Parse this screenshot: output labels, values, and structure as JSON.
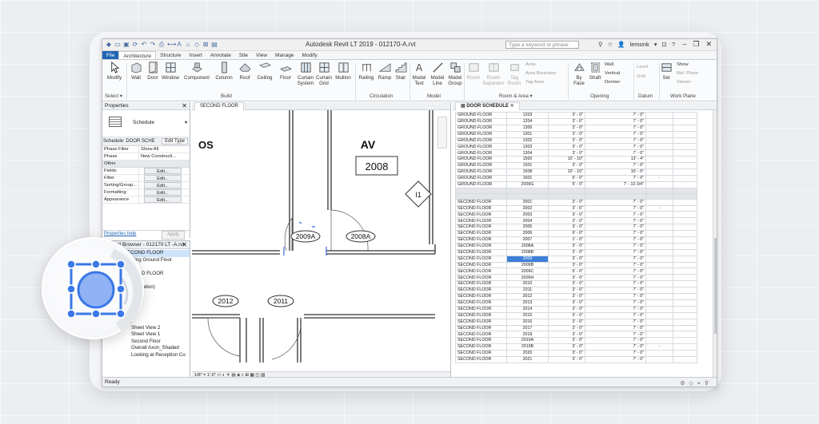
{
  "app": {
    "title": "Autodesk Revit LT 2019 - 012170-A.rvt",
    "search_placeholder": "Type a keyword or phrase",
    "user": "lemonk",
    "accent": "#1f65b5"
  },
  "tabs": [
    "File",
    "Architecture",
    "Structure",
    "Insert",
    "Annotate",
    "Site",
    "View",
    "Manage",
    "Modify"
  ],
  "ribbon": {
    "buttons": {
      "modify": "Modify",
      "wall": "Wall",
      "door": "Door",
      "window": "Window",
      "component": "Component",
      "column": "Column",
      "roof": "Roof",
      "ceiling": "Ceiling",
      "floor": "Floor",
      "curtain_system": "Curtain System",
      "curtain_grid": "Curtain Grid",
      "mullion": "Mullion",
      "railing": "Railing",
      "ramp": "Ramp",
      "stair": "Stair",
      "model_text": "Model Text",
      "model_line": "Model Line",
      "model_group": "Model Group",
      "room": "Room",
      "room_separator": "Room Separator",
      "tag_room": "Tag Room",
      "area": "Area",
      "area_boundary": "Area Boundary",
      "tag_area": "Tag Area",
      "by_face": "By Face",
      "shaft": "Shaft",
      "wall_opening": "Wall",
      "vertical": "Vertical",
      "dormer": "Dormer",
      "level": "Level",
      "grid": "Grid",
      "set": "Set",
      "show": "Show",
      "ref_plane": "Ref. Plane",
      "viewer": "Viewer"
    },
    "panels": {
      "select": "Select",
      "build": "Build",
      "circulation": "Circulation",
      "model": "Model",
      "room_area": "Room & Area",
      "opening": "Opening",
      "datum": "Datum",
      "work_plane": "Work Plane"
    }
  },
  "properties": {
    "title": "Properties",
    "type_name": "Schedule",
    "instance_label": "Schedule: DOOR SCHE",
    "edit_type": "Edit Type",
    "rows": [
      {
        "k": "Phase Filter",
        "v": "Show All"
      },
      {
        "k": "Phase",
        "v": "New Constructi..."
      }
    ],
    "section_other": "Other",
    "edit_rows": [
      {
        "k": "Fields",
        "v": "Edit..."
      },
      {
        "k": "Filter",
        "v": "Edit..."
      },
      {
        "k": "Sorting/Group...",
        "v": "Edit..."
      },
      {
        "k": "Formatting",
        "v": "Edit..."
      },
      {
        "k": "Appearance",
        "v": "Edit..."
      }
    ],
    "help": "Properties help",
    "apply": "Apply"
  },
  "browser": {
    "title": "Project Browser - 012170 LT -A.rvt",
    "items": [
      {
        "label": "SECOND FLOOR",
        "indent": 3,
        "selected": true
      },
      {
        "label": "Existing Ground Floor",
        "indent": 3,
        "selected": false
      },
      {
        "label": "PLAN",
        "indent": 3,
        "selected": false
      },
      {
        "label": "SECOND FLOOR",
        "indent": 3,
        "selected": false
      },
      {
        "label": "Level",
        "indent": 3,
        "selected": false
      },
      {
        "label": "(Presentation)",
        "indent": 3,
        "selected": false
      },
      {
        "label": "",
        "indent": 3,
        "selected": false
      },
      {
        "label": "FLOOR",
        "indent": 3,
        "selected": false
      },
      {
        "label": "FLOOR",
        "indent": 3,
        "selected": false
      },
      {
        "label": "Level",
        "indent": 3,
        "selected": false
      },
      {
        "label": "s",
        "indent": 3,
        "selected": false
      },
      {
        "label": "3D)",
        "indent": 3,
        "selected": false
      },
      {
        "label": "Sheet View 2",
        "indent": 4,
        "selected": false
      },
      {
        "label": "Sheet View 1",
        "indent": 4,
        "selected": false
      },
      {
        "label": "Second Floor",
        "indent": 4,
        "selected": false
      },
      {
        "label": "Overall Axon_Shaded",
        "indent": 4,
        "selected": false
      },
      {
        "label": "Looking at Reception Co",
        "indent": 4,
        "selected": false
      }
    ]
  },
  "plan": {
    "tab": "SECOND FLOOR",
    "room_name_left": "OS",
    "room_name": "AV",
    "room_number": "2008",
    "elevation_tag": "I1",
    "door_tags": [
      "2009A",
      "2008A",
      "2012",
      "2011"
    ],
    "scale": "1/8\" = 1'-0\""
  },
  "schedule": {
    "tab": "DOOR SCHEDULE",
    "ground": [
      [
        "GROUND FLOOR",
        "1203",
        "3' - 0\"",
        "7' - 0\"",
        ""
      ],
      [
        "GROUND FLOOR",
        "1204",
        "3' - 0\"",
        "7' - 0\"",
        ""
      ],
      [
        "GROUND FLOOR",
        "1300",
        "3' - 0\"",
        "7' - 0\"",
        ""
      ],
      [
        "GROUND FLOOR",
        "1301",
        "3' - 0\"",
        "7' - 0\"",
        ""
      ],
      [
        "GROUND FLOOR",
        "1302",
        "3' - 0\"",
        "7' - 0\"",
        ""
      ],
      [
        "GROUND FLOOR",
        "1303",
        "3' - 0\"",
        "7' - 0\"",
        ""
      ],
      [
        "GROUND FLOOR",
        "1304",
        "3' - 0\"",
        "7' - 0\"",
        ""
      ],
      [
        "GROUND FLOOR",
        "1500",
        "10' - 10\"",
        "13' - 4\"",
        ""
      ],
      [
        "GROUND FLOOR",
        "1501",
        "3' - 0\"",
        "7' - 0\"",
        ""
      ],
      [
        "GROUND FLOOR",
        "1508",
        "10' - 10\"",
        "10' - 0\"",
        ""
      ],
      [
        "GROUND FLOOR",
        "1601",
        "6' - 0\"",
        "7' - 0\"",
        "-"
      ],
      [
        "GROUND FLOOR",
        "2009G",
        "5' - 0\"",
        "7' - 10 3/4\"",
        ""
      ]
    ],
    "second": [
      [
        "SECOND FLOOR",
        "2001",
        "3' - 0\"",
        "7' - 0\"",
        ""
      ],
      [
        "SECOND FLOOR",
        "2002",
        "3' - 6\"",
        "7' - 0\"",
        "-"
      ],
      [
        "SECOND FLOOR",
        "2003",
        "3' - 0\"",
        "7' - 0\"",
        ""
      ],
      [
        "SECOND FLOOR",
        "2004",
        "3' - 0\"",
        "7' - 0\"",
        ""
      ],
      [
        "SECOND FLOOR",
        "2005",
        "3' - 0\"",
        "7' - 0\"",
        ""
      ],
      [
        "SECOND FLOOR",
        "2006",
        "6' - 0\"",
        "7' - 0\"",
        ""
      ],
      [
        "SECOND FLOOR",
        "2007",
        "1' - 0\"",
        "7' - 0\"",
        ""
      ],
      [
        "SECOND FLOOR",
        "2008A",
        "3' - 0\"",
        "7' - 0\"",
        ""
      ],
      [
        "SECOND FLOOR",
        "2008B",
        "3' - 0\"",
        "7' - 0\"",
        ""
      ],
      [
        "SECOND FLOOR",
        "2009",
        "3' - 0\"",
        "7' - 0\"",
        ""
      ],
      [
        "SECOND FLOOR",
        "2009B",
        "3' - 0\"",
        "7' - 0\"",
        ""
      ],
      [
        "SECOND FLOOR",
        "2009C",
        "6' - 0\"",
        "7' - 0\"",
        ""
      ],
      [
        "SECOND FLOOR",
        "2009H",
        "3' - 0\"",
        "7' - 0\"",
        ""
      ],
      [
        "SECOND FLOOR",
        "2010",
        "3' - 0\"",
        "7' - 0\"",
        ""
      ],
      [
        "SECOND FLOOR",
        "2011",
        "3' - 0\"",
        "7' - 0\"",
        ""
      ],
      [
        "SECOND FLOOR",
        "2012",
        "3' - 0\"",
        "7' - 0\"",
        ""
      ],
      [
        "SECOND FLOOR",
        "2013",
        "3' - 0\"",
        "7' - 0\"",
        ""
      ],
      [
        "SECOND FLOOR",
        "2014",
        "3' - 0\"",
        "7' - 0\"",
        ""
      ],
      [
        "SECOND FLOOR",
        "2015",
        "3' - 0\"",
        "7' - 0\"",
        ""
      ],
      [
        "SECOND FLOOR",
        "2016",
        "3' - 0\"",
        "7' - 0\"",
        ""
      ],
      [
        "SECOND FLOOR",
        "2017",
        "3' - 0\"",
        "7' - 0\"",
        ""
      ],
      [
        "SECOND FLOOR",
        "2018",
        "3' - 0\"",
        "7' - 0\"",
        ""
      ],
      [
        "SECOND FLOOR",
        "2019A",
        "3' - 0\"",
        "7' - 0\"",
        ""
      ],
      [
        "SECOND FLOOR",
        "2019B",
        "3' - 0\"",
        "7' - 0\"",
        "-"
      ],
      [
        "SECOND FLOOR",
        "2020",
        "3' - 0\"",
        "7' - 0\"",
        ""
      ],
      [
        "SECOND FLOOR",
        "2021",
        "3' - 0\"",
        "7' - 0\"",
        ""
      ]
    ],
    "selected_row": 9
  },
  "status": {
    "text": "Ready"
  }
}
